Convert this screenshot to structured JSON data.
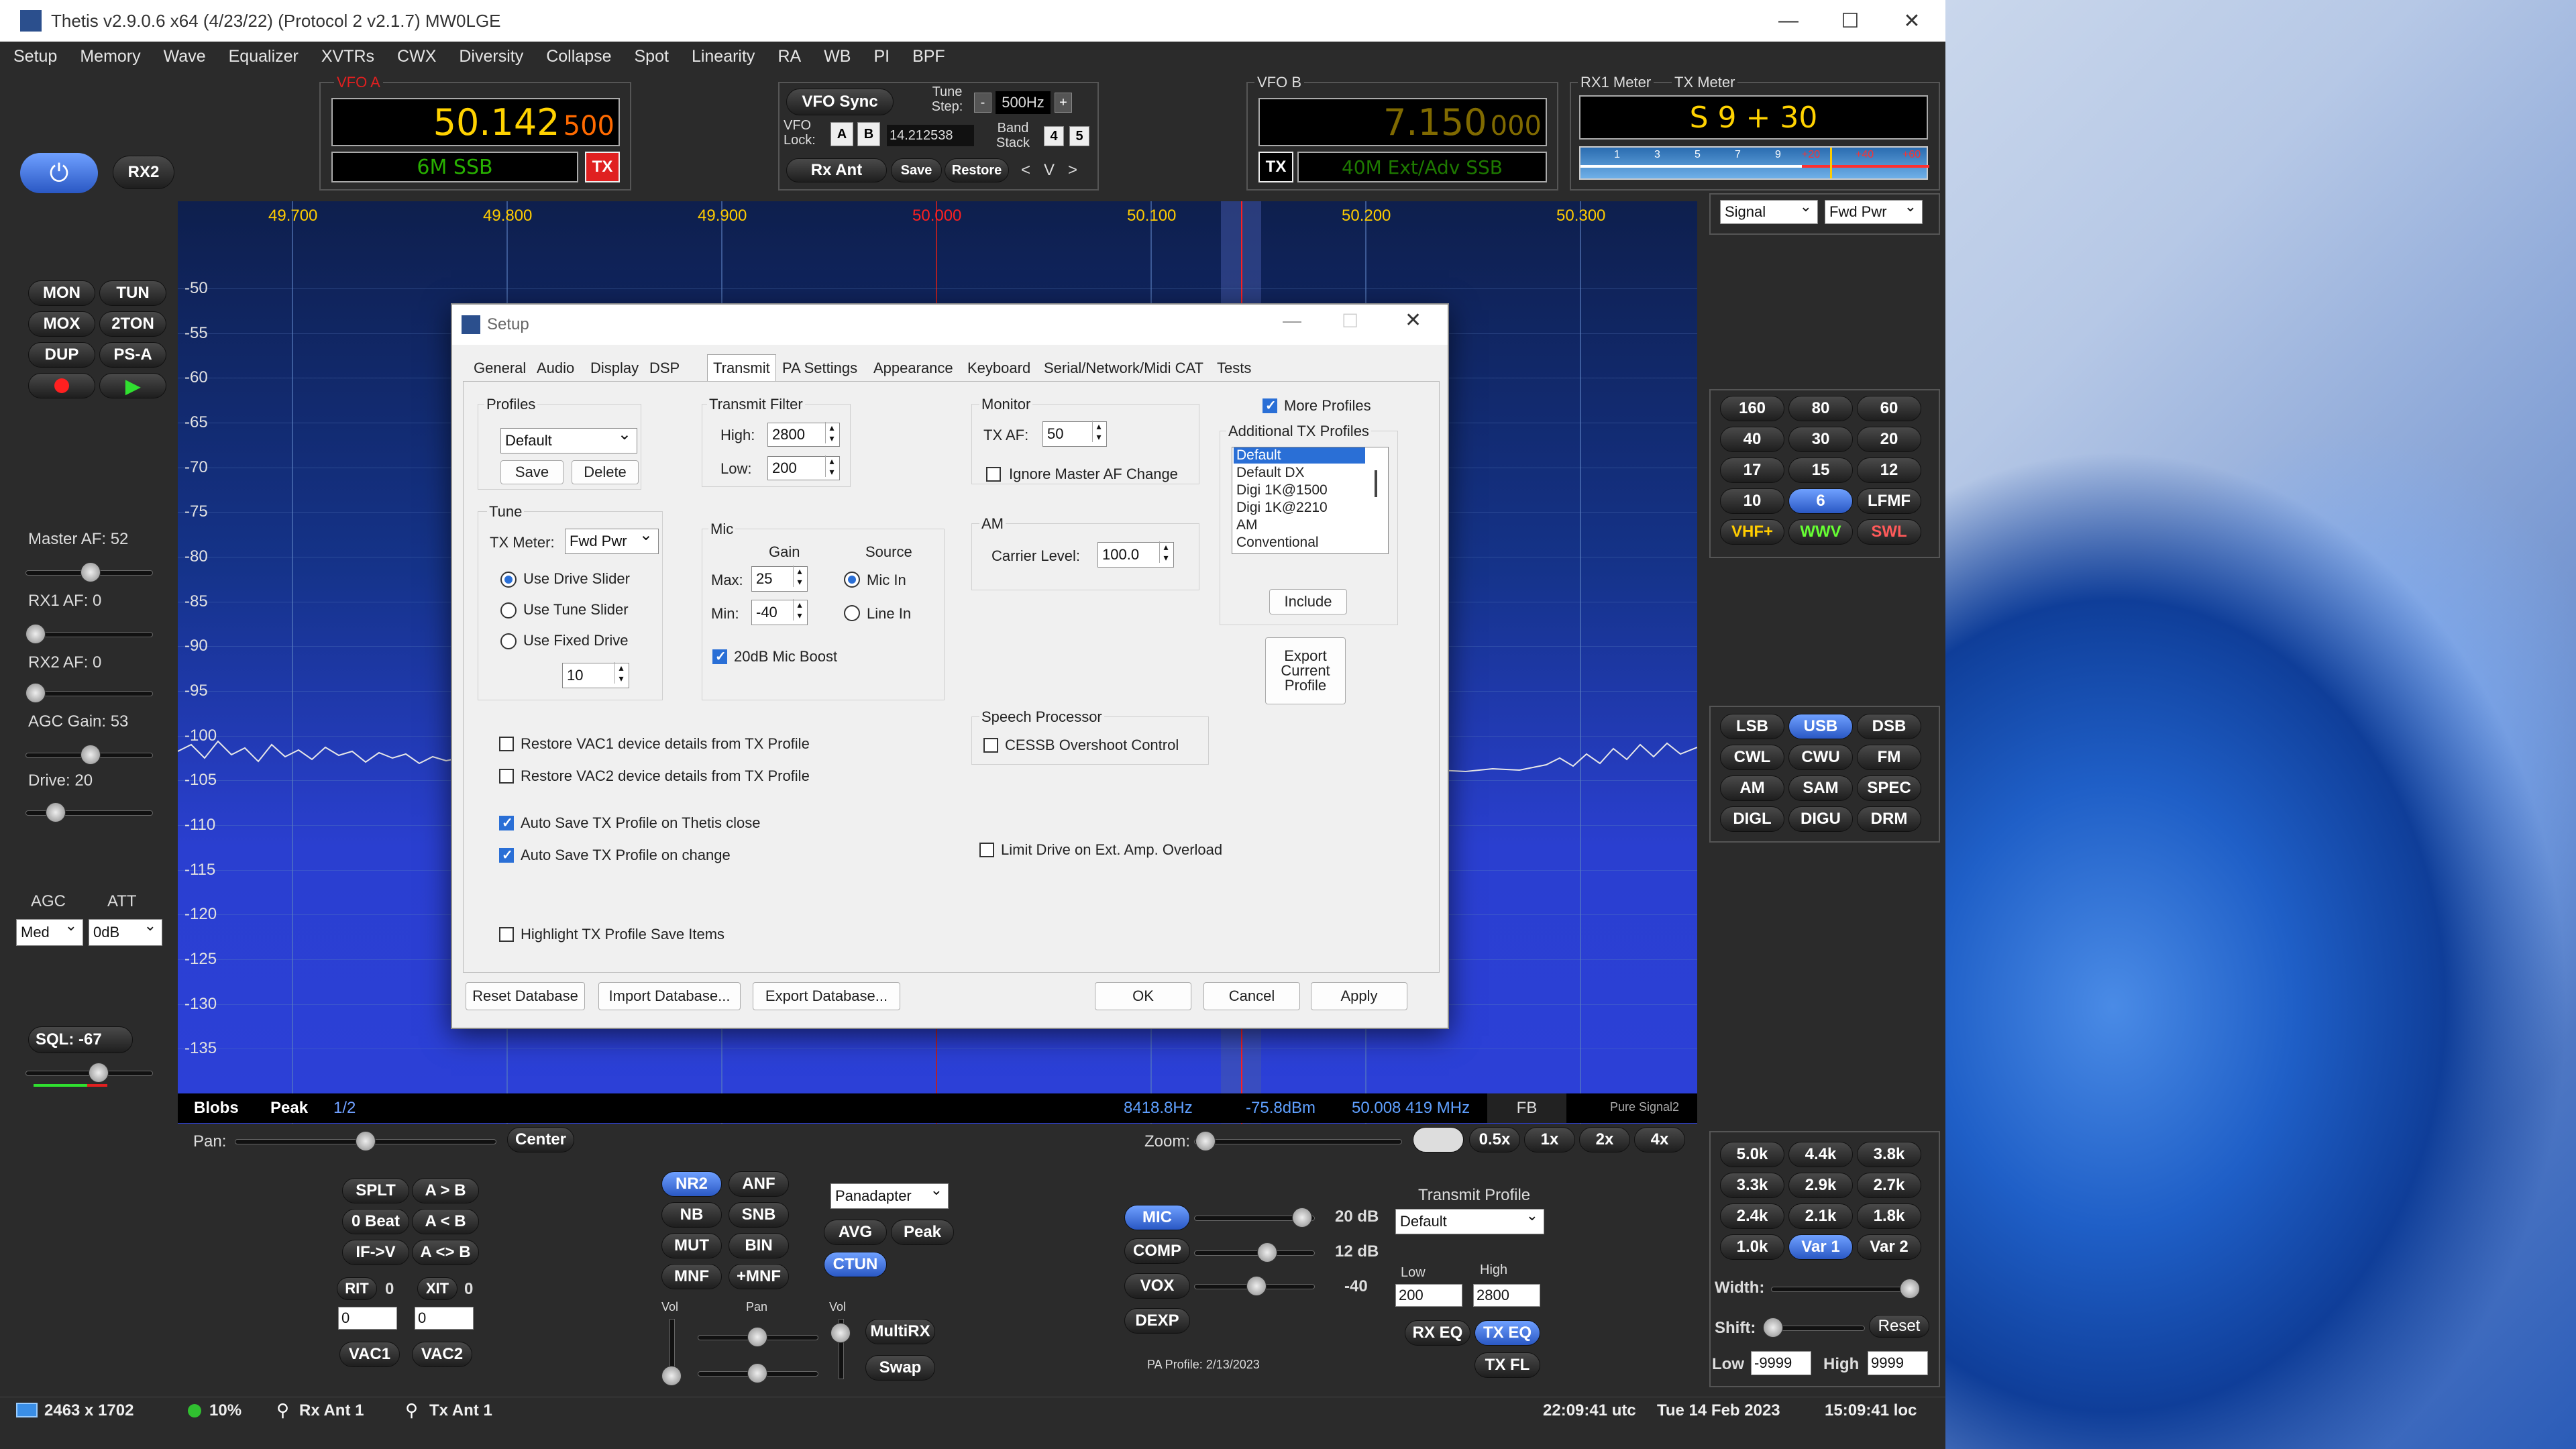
{
  "window": {
    "title": "Thetis v2.9.0.6 x64 (4/23/22) (Protocol 2 v2.1.7) MW0LGE",
    "min": "—",
    "max": "☐",
    "close": "✕"
  },
  "menu": [
    "Setup",
    "Memory",
    "Wave",
    "Equalizer",
    "XVTRs",
    "CWX",
    "Diversity",
    "Collapse",
    "Spot",
    "Linearity",
    "RA",
    "WB",
    "PI",
    "BPF"
  ],
  "vfoa": {
    "label": "VFO A",
    "freq": "50.142",
    "sub": "500",
    "mode": "6M SSB",
    "tx": "TX"
  },
  "vfob": {
    "label": "VFO B",
    "freq": "7.150",
    "sub": "000",
    "mode": "40M Ext/Adv SSB",
    "tx": "TX"
  },
  "vfocenter": {
    "sync": "VFO Sync",
    "tune_step_label": "Tune Step:",
    "tune_step": "500Hz",
    "minus": "-",
    "plus": "+",
    "lock_label": "VFO Lock:",
    "a": "A",
    "b": "B",
    "lockfreq": "14.212538",
    "band_stack_label": "Band Stack",
    "bs1": "4",
    "bs2": "5",
    "rxant": "Rx Ant",
    "save": "Save",
    "restore": "Restore",
    "arrows": "<   V   >"
  },
  "meters": {
    "rx1": "RX1 Meter",
    "tx": "TX Meter",
    "reading": "S 9 + 30",
    "scale": [
      "1",
      "3",
      "5",
      "7",
      "9",
      "+20",
      "+40",
      "+60"
    ],
    "rx_sel": "Signal",
    "tx_sel": "Fwd Pwr"
  },
  "power": {
    "rx2": "RX2"
  },
  "leftbtns": [
    "MON",
    "TUN",
    "MOX",
    "2TON",
    "DUP",
    "PS-A"
  ],
  "sliders": {
    "master_af": "Master AF:  52",
    "rx1_af": "RX1 AF:  0",
    "rx2_af": "RX2 AF:  0",
    "agc_gain": "AGC Gain:  53",
    "drive": "Drive:  20",
    "agc_label": "AGC",
    "att_label": "ATT",
    "agc": "Med",
    "att": "0dB",
    "sql": "SQL:  -67"
  },
  "pan": {
    "freqs": [
      "49.700",
      "49.800",
      "49.900",
      "50.000",
      "50.100",
      "50.200",
      "50.300"
    ],
    "db": [
      "-50",
      "-55",
      "-60",
      "-65",
      "-70",
      "-75",
      "-80",
      "-85",
      "-90",
      "-95",
      "-100",
      "-105",
      "-110",
      "-115",
      "-120",
      "-125",
      "-130",
      "-135"
    ],
    "bottom": {
      "blobs": "Blobs",
      "peak": "Peak",
      "page": "1/2",
      "cursor_hz": "8418.8Hz",
      "cursor_db": "-75.8dBm",
      "cursor_mhz": "50.008 419 MHz",
      "fb": "FB",
      "ps": "Pure Signal2"
    }
  },
  "bands": [
    "160",
    "80",
    "60",
    "40",
    "30",
    "20",
    "17",
    "15",
    "12",
    "10",
    "6",
    "LFMF",
    "VHF+",
    "WWV",
    "SWL"
  ],
  "modes": [
    "LSB",
    "USB",
    "DSB",
    "CWL",
    "CWU",
    "FM",
    "AM",
    "SAM",
    "SPEC",
    "DIGL",
    "DIGU",
    "DRM"
  ],
  "filters": [
    "5.0k",
    "4.4k",
    "3.8k",
    "3.3k",
    "2.9k",
    "2.7k",
    "2.4k",
    "2.1k",
    "1.8k",
    "1.0k",
    "Var 1",
    "Var 2"
  ],
  "filterctl": {
    "width": "Width:",
    "shift": "Shift:",
    "reset": "Reset",
    "low": "Low",
    "low_val": "-9999",
    "high": "High",
    "high_val": "9999"
  },
  "lower": {
    "pan": "Pan:",
    "center": "Center",
    "zoom": "Zoom:",
    "zooms": [
      "0.5x",
      "1x",
      "2x",
      "4x"
    ],
    "splt": "SPLT",
    "a2b": "A > B",
    "zbeat": "0 Beat",
    "a_b": "A < B",
    "ifv": "IF->V",
    "aswap": "A <> B",
    "rit": "RIT",
    "rit_v": "0",
    "xit": "XIT",
    "xit_v": "0",
    "rit_num": "0",
    "xit_num": "0",
    "vac1": "VAC1",
    "vac2": "VAC2",
    "nr2": "NR2",
    "anf": "ANF",
    "nb": "NB",
    "snb": "SNB",
    "mut": "MUT",
    "bin": "BIN",
    "mnf": "MNF",
    "pmnf": "+MNF",
    "display": "Panadapter",
    "avg": "AVG",
    "peak": "Peak",
    "ctun": "CTUN",
    "vol": "Vol",
    "pan2": "Pan",
    "vol2": "Vol",
    "multirx": "MultiRX",
    "swap": "Swap",
    "mic": "MIC",
    "mic_db": "20 dB",
    "comp": "COMP",
    "comp_db": "12 dB",
    "vox": "VOX",
    "vox_db": "-40",
    "dexp": "DEXP",
    "pa_profile": "PA Profile: 2/13/2023",
    "tx_profile_label": "Transmit Profile",
    "tx_profile": "Default",
    "low": "Low",
    "high": "High",
    "low_v": "200",
    "high_v": "2800",
    "rxeq": "RX EQ",
    "txeq": "TX EQ",
    "txfl": "TX FL"
  },
  "status": {
    "res": "2463 x 1702",
    "cpu": "10%",
    "rxant": "Rx Ant 1",
    "txant": "Tx Ant 1",
    "utc": "22:09:41 utc",
    "date": "Tue 14 Feb 2023",
    "loc": "15:09:41 loc"
  },
  "setup": {
    "title": "Setup",
    "tabs": [
      "General",
      "Audio",
      "Display",
      "DSP",
      "Transmit",
      "PA Settings",
      "Appearance",
      "Keyboard",
      "Serial/Network/Midi CAT",
      "Tests"
    ],
    "profiles": {
      "label": "Profiles",
      "value": "Default",
      "save": "Save",
      "delete": "Delete"
    },
    "filter": {
      "label": "Transmit Filter",
      "high_l": "High:",
      "high": "2800",
      "low_l": "Low:",
      "low": "200"
    },
    "monitor": {
      "label": "Monitor",
      "txaf_l": "TX AF:",
      "txaf": "50",
      "ignore": "Ignore Master AF Change"
    },
    "more": {
      "label": "More Profiles",
      "add_label": "Additional TX Profiles",
      "items": [
        "Default",
        "Default DX",
        "Digi 1K@1500",
        "Digi 1K@2210",
        "AM",
        "Conventional"
      ],
      "include": "Include",
      "export": "Export Current Profile"
    },
    "tune": {
      "label": "Tune",
      "meter_l": "TX Meter:",
      "meter": "Fwd Pwr",
      "r1": "Use Drive Slider",
      "r2": "Use Tune Slider",
      "r3": "Use Fixed Drive",
      "fixed": "10"
    },
    "mic": {
      "label": "Mic",
      "gain": "Gain",
      "source": "Source",
      "max_l": "Max:",
      "max": "25",
      "min_l": "Min:",
      "min": "-40",
      "micin": "Mic In",
      "linein": "Line In",
      "boost": "20dB Mic Boost"
    },
    "am": {
      "label": "AM",
      "carrier_l": "Carrier Level:",
      "carrier": "100.0"
    },
    "speech": {
      "label": "Speech Processor",
      "cessb": "CESSB Overshoot Control"
    },
    "checks": [
      "Restore VAC1 device details from TX Profile",
      "Restore VAC2 device details from TX Profile",
      "Auto Save TX Profile on Thetis close",
      "Auto Save TX Profile on change",
      "Highlight TX Profile Save Items"
    ],
    "limit": "Limit Drive on Ext. Amp. Overload",
    "buttons": {
      "reset": "Reset Database",
      "import": "Import Database...",
      "export": "Export Database...",
      "ok": "OK",
      "cancel": "Cancel",
      "apply": "Apply"
    }
  }
}
